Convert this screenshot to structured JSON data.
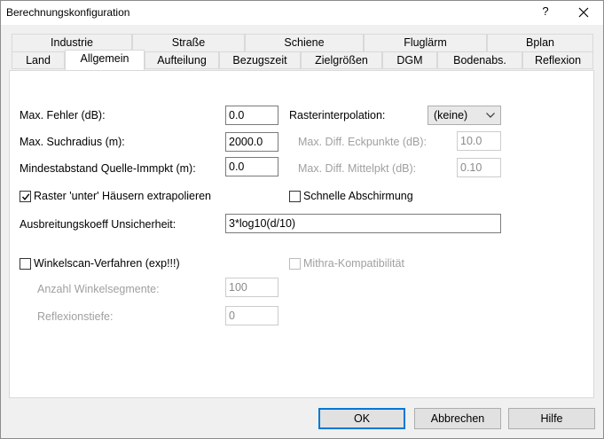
{
  "window": {
    "title": "Berechnungskonfiguration",
    "help_glyph": "?"
  },
  "tabs_row_top": [
    "Industrie",
    "Straße",
    "Schiene",
    "Fluglärm",
    "Bplan"
  ],
  "tabs_row_bottom": [
    "Land",
    "Allgemein",
    "Aufteilung",
    "Bezugszeit",
    "Zielgrößen",
    "DGM",
    "Bodenabs.",
    "Reflexion"
  ],
  "active_tab": "Allgemein",
  "form": {
    "max_fehler": {
      "label": "Max. Fehler (dB):",
      "value": "0.0"
    },
    "max_suchradius": {
      "label": "Max. Suchradius (m):",
      "value": "2000.0"
    },
    "mindestabstand": {
      "label": "Mindestabstand Quelle-Immpkt (m):",
      "value": "0.0"
    },
    "rasterinterpolation": {
      "label": "Rasterinterpolation:",
      "value": "(keine)"
    },
    "max_diff_eckpunkte": {
      "label": "Max. Diff. Eckpunkte (dB):",
      "value": "10.0"
    },
    "max_diff_mittelpkt": {
      "label": "Max. Diff. Mittelpkt (dB):",
      "value": "0.10"
    },
    "raster_extrapolieren": {
      "label": "Raster 'unter' Häusern extrapolieren",
      "checked": true
    },
    "schnelle_abschirmung": {
      "label": "Schnelle Abschirmung",
      "checked": false
    },
    "ausbreitungskoeff": {
      "label": "Ausbreitungskoeff Unsicherheit:",
      "value": "3*log10(d/10)"
    },
    "winkelscan": {
      "label": "Winkelscan-Verfahren (exp!!!)",
      "checked": false
    },
    "mithra": {
      "label": "Mithra-Kompatibilität",
      "checked": false
    },
    "anzahl_winkelsegmente": {
      "label": "Anzahl Winkelsegmente:",
      "value": "100"
    },
    "reflexionstiefe": {
      "label": "Reflexionstiefe:",
      "value": "0"
    }
  },
  "buttons": {
    "ok": "OK",
    "cancel": "Abbrechen",
    "help": "Hilfe"
  },
  "colors": {
    "accent": "#0078d7",
    "disabled_text": "#a0a0a0"
  }
}
